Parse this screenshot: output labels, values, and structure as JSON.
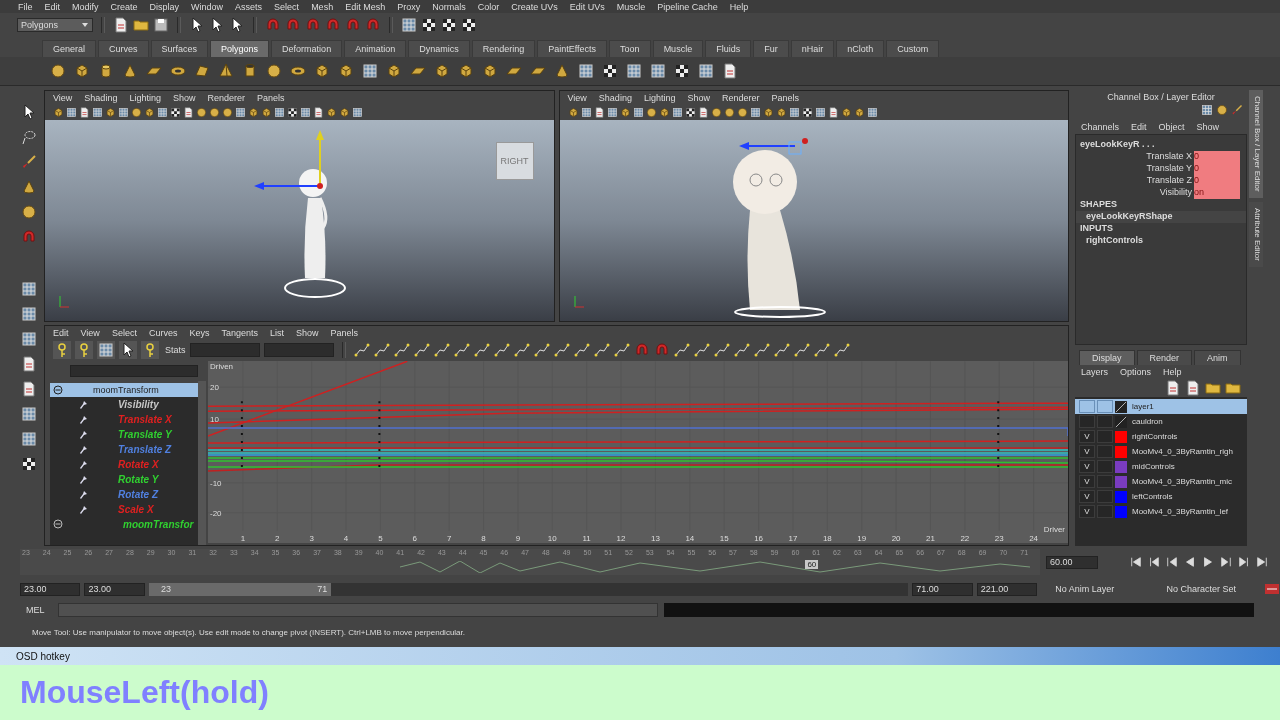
{
  "menu_bar": [
    "File",
    "Edit",
    "Modify",
    "Create",
    "Display",
    "Window",
    "Assets",
    "Select",
    "Mesh",
    "Edit Mesh",
    "Proxy",
    "Normals",
    "Color",
    "Create UVs",
    "Edit UVs",
    "Muscle",
    "Pipeline Cache",
    "Help"
  ],
  "status_line": {
    "mode_menu": "Polygons"
  },
  "shelf_tabs": [
    {
      "label": "General",
      "selected": false
    },
    {
      "label": "Curves",
      "selected": false
    },
    {
      "label": "Surfaces",
      "selected": false
    },
    {
      "label": "Polygons",
      "selected": true
    },
    {
      "label": "Deformation",
      "selected": false
    },
    {
      "label": "Animation",
      "selected": false
    },
    {
      "label": "Dynamics",
      "selected": false
    },
    {
      "label": "Rendering",
      "selected": false
    },
    {
      "label": "PaintEffects",
      "selected": false
    },
    {
      "label": "Toon",
      "selected": false
    },
    {
      "label": "Muscle",
      "selected": false
    },
    {
      "label": "Fluids",
      "selected": false
    },
    {
      "label": "Fur",
      "selected": false
    },
    {
      "label": "nHair",
      "selected": false
    },
    {
      "label": "nCloth",
      "selected": false
    },
    {
      "label": "Custom",
      "selected": false
    }
  ],
  "viewports": [
    {
      "kind": "full",
      "menu": [
        "View",
        "Shading",
        "Lighting",
        "Show",
        "Renderer",
        "Panels"
      ],
      "view_cube": "RIGHT"
    },
    {
      "kind": "closeup",
      "menu": [
        "View",
        "Shading",
        "Lighting",
        "Show",
        "Renderer",
        "Panels"
      ]
    }
  ],
  "graph_editor": {
    "menu": [
      "Edit",
      "View",
      "Select",
      "Curves",
      "Keys",
      "Tangents",
      "List",
      "Show",
      "Panels"
    ],
    "stats_label": "Stats",
    "outliner": [
      {
        "name": "moomTransform",
        "selected": true,
        "expanded": true,
        "children": [
          {
            "name": "Visibility",
            "color": "#c8c8c8"
          },
          {
            "name": "Translate X",
            "color": "#e02020"
          },
          {
            "name": "Translate Y",
            "color": "#30d030"
          },
          {
            "name": "Translate Z",
            "color": "#5080e0"
          },
          {
            "name": "Rotate X",
            "color": "#e02020"
          },
          {
            "name": "Rotate Y",
            "color": "#30d030"
          },
          {
            "name": "Rotate Z",
            "color": "#5080e0"
          },
          {
            "name": "Scale X",
            "color": "#e02020"
          }
        ]
      },
      {
        "name": "moomTransfor",
        "selected": false,
        "expanded": true,
        "color": "#30d030"
      }
    ],
    "graph": {
      "top_label": "Driven",
      "bottom_label": "Driver",
      "y_labels": [
        "20",
        "10",
        "-10",
        "-20"
      ],
      "x_labels": [
        "1",
        "2",
        "3",
        "4",
        "5",
        "6",
        "7",
        "8",
        "9",
        "10",
        "11",
        "12",
        "13",
        "14",
        "15",
        "16",
        "17",
        "18",
        "19",
        "20",
        "21",
        "22",
        "23",
        "24"
      ]
    }
  },
  "channel_box": {
    "title": "Channel Box / Layer Editor",
    "menu": [
      "Channels",
      "Edit",
      "Object",
      "Show"
    ],
    "object": "eyeLookKeyR . . .",
    "channels": [
      {
        "name": "Translate X",
        "value": "0",
        "keyed": true
      },
      {
        "name": "Translate Y",
        "value": "0",
        "keyed": true
      },
      {
        "name": "Translate Z",
        "value": "0",
        "keyed": true
      },
      {
        "name": "Visibility",
        "value": "on",
        "keyed": true
      }
    ],
    "shapes_header": "SHAPES",
    "shapes": [
      "eyeLookKeyRShape"
    ],
    "inputs_header": "INPUTS",
    "inputs": [
      "rightControls"
    ],
    "side_tabs": [
      {
        "label": "Channel Box / Layer Editor",
        "selected": true
      },
      {
        "label": "Attribute Editor",
        "selected": false
      }
    ]
  },
  "layer_editor": {
    "tabs": [
      {
        "label": "Display",
        "selected": true
      },
      {
        "label": "Render",
        "selected": false
      },
      {
        "label": "Anim",
        "selected": false
      }
    ],
    "menu": [
      "Layers",
      "Options",
      "Help"
    ],
    "layers": [
      {
        "name": "layer1",
        "selected": true
      },
      {
        "name": "cauldron",
        "selected": false
      },
      {
        "name": "rightControls",
        "visibility": "V",
        "color": "#ff0000",
        "selected": false
      },
      {
        "name": "MooMv4_0_3ByRamtin_righ",
        "visibility": "V",
        "color": "#ff0000",
        "selected": false
      },
      {
        "name": "midControls",
        "visibility": "V",
        "color": "#7a3cc0",
        "selected": false
      },
      {
        "name": "MooMv4_0_3ByRamtin_mic",
        "visibility": "V",
        "color": "#7a3cc0",
        "selected": false
      },
      {
        "name": "leftControls",
        "visibility": "V",
        "color": "#0000ff",
        "selected": false
      },
      {
        "name": "MooMv4_0_3ByRamtin_lef",
        "visibility": "V",
        "color": "#0000ff",
        "selected": false
      }
    ]
  },
  "time_slider": {
    "ticks": [
      "23",
      "24",
      "25",
      "26",
      "27",
      "28",
      "29",
      "30",
      "31",
      "32",
      "33",
      "34",
      "35",
      "36",
      "37",
      "38",
      "39",
      "40",
      "41",
      "42",
      "43",
      "44",
      "45",
      "46",
      "47",
      "48",
      "49",
      "50",
      "51",
      "52",
      "53",
      "54",
      "55",
      "56",
      "57",
      "58",
      "59",
      "60",
      "61",
      "62",
      "63",
      "64",
      "65",
      "66",
      "67",
      "68",
      "69",
      "70",
      "71"
    ],
    "current_frame": "60",
    "level": 0.77,
    "frame_field": "60.00"
  },
  "range_slider": {
    "start": "23.00",
    "range_start": "23.00",
    "bar_start": "23",
    "bar_end": "71",
    "level": 0.24,
    "range_end": "71.00",
    "end": "221.00",
    "anim_layer": "No Anim Layer",
    "character_set": "No Character Set"
  },
  "command_line": {
    "label": "MEL"
  },
  "help_line": "Move Tool: Use manipulator to move object(s). Use edit mode to change pivot (INSERT).  Ctrl+LMB to move perpendicular.",
  "osd": {
    "title": "OSD hotkey",
    "text": "MouseLeft(hold)"
  }
}
